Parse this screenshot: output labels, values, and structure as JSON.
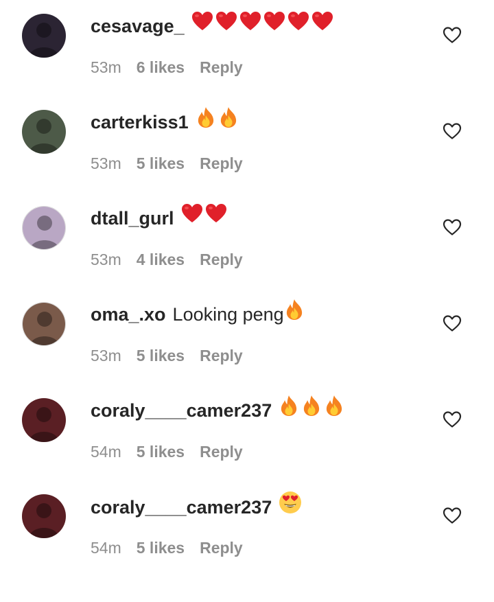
{
  "comments": [
    {
      "username": "cesavage_",
      "text": "",
      "emoji": [
        "heart",
        "heart",
        "heart",
        "heart",
        "heart",
        "heart"
      ],
      "time": "53m",
      "likes": "6 likes",
      "reply": "Reply",
      "avatar_color": "#2b2433",
      "avatar_border": false
    },
    {
      "username": "carterkiss1",
      "text": "",
      "emoji": [
        "fire",
        "fire"
      ],
      "time": "53m",
      "likes": "5 likes",
      "reply": "Reply",
      "avatar_color": "#4d5a48",
      "avatar_border": false
    },
    {
      "username": "dtall_gurl",
      "text": "",
      "emoji": [
        "heart",
        "heart"
      ],
      "time": "53m",
      "likes": "4 likes",
      "reply": "Reply",
      "avatar_color": "#b9a7c4",
      "avatar_border": true
    },
    {
      "username": "oma_.xo",
      "text": "Looking peng",
      "emoji": [
        "fire"
      ],
      "time": "53m",
      "likes": "5 likes",
      "reply": "Reply",
      "avatar_color": "#7a5a4a",
      "avatar_border": true
    },
    {
      "username": "coraly____camer237",
      "text": "",
      "emoji": [
        "fire",
        "fire",
        "fire"
      ],
      "time": "54m",
      "likes": "5 likes",
      "reply": "Reply",
      "avatar_color": "#5a1f24",
      "avatar_border": false
    },
    {
      "username": "coraly____camer237",
      "text": "",
      "emoji": [
        "heart-eyes"
      ],
      "time": "54m",
      "likes": "5 likes",
      "reply": "Reply",
      "avatar_color": "#5a1f24",
      "avatar_border": false
    }
  ],
  "colors": {
    "username": "#262626",
    "meta": "#8e8e8e",
    "heart_emoji": "#e0202a",
    "fire_outer": "#f58220",
    "fire_inner": "#ffcc33"
  },
  "icons": {
    "like": "heart-outline-icon"
  }
}
